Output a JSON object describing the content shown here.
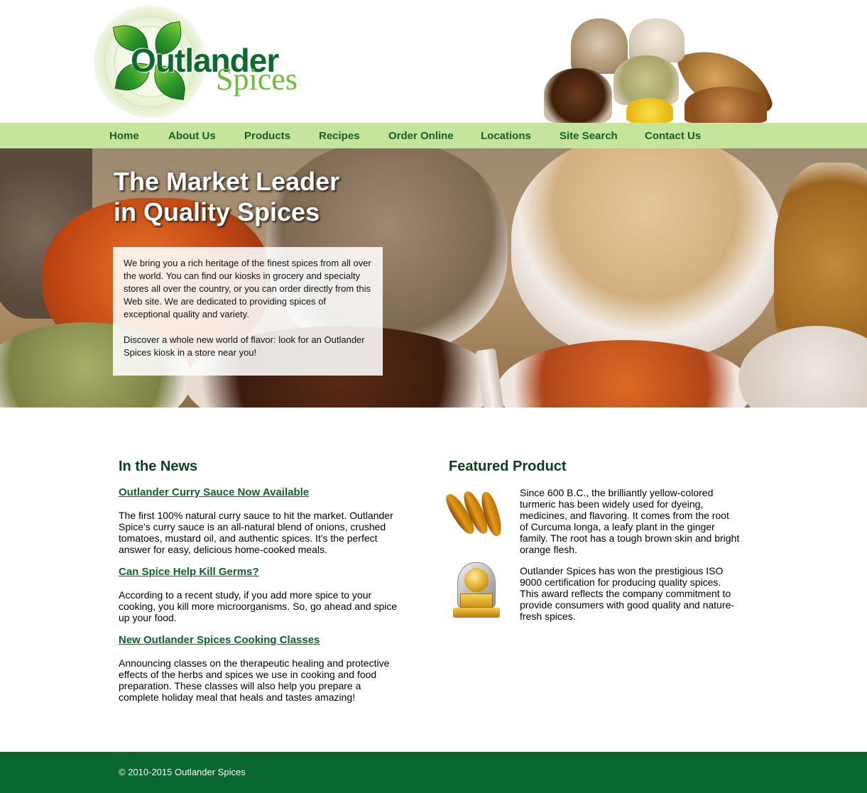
{
  "brand": {
    "name_word1": "Outlander",
    "name_word2": "Spices"
  },
  "nav": {
    "items": [
      {
        "label": "Home"
      },
      {
        "label": "About Us"
      },
      {
        "label": "Products"
      },
      {
        "label": "Recipes"
      },
      {
        "label": "Order Online"
      },
      {
        "label": "Locations"
      },
      {
        "label": "Site Search"
      },
      {
        "label": "Contact Us"
      }
    ]
  },
  "hero": {
    "title_line1": "The Market Leader",
    "title_line2": "in Quality Spices",
    "paragraph1": "We bring you a rich heritage of the finest spices from all over the world. You can find our kiosks in grocery and specialty stores all over the country, or you can order directly from this Web site. We are dedicated to providing spices of exceptional quality and variety.",
    "paragraph2": "Discover a whole new world of flavor: look for an Outlander Spices kiosk in a store near you!"
  },
  "news": {
    "heading": "In the News",
    "items": [
      {
        "title": "Outlander Curry Sauce Now Available",
        "body": "The first 100% natural curry sauce to hit the market. Outlander Spice's curry sauce is an all-natural blend of onions, crushed tomatoes, mustard oil, and authentic spices. It's the perfect answer for easy, delicious home-cooked meals."
      },
      {
        "title": "Can Spice Help Kill Germs?",
        "body": "According to a recent study, if you add more spice to your cooking, you kill more microorganisms. So, go ahead and spice up your food."
      },
      {
        "title": "New Outlander Spices Cooking Classes",
        "body": "Announcing classes on the therapeutic healing and protective effects of the herbs and spices we use in cooking and food preparation. These classes will also help you prepare a complete holiday meal that heals and tastes amazing!"
      }
    ]
  },
  "featured": {
    "heading": "Featured Product",
    "items": [
      {
        "icon": "turmeric-icon",
        "text": "Since 600 B.C., the brilliantly yellow-colored turmeric has been widely used for dyeing, medicines, and flavoring. It comes from the root of Curcuma longa, a leafy plant in the ginger family. The root has a tough brown skin and bright orange flesh."
      },
      {
        "icon": "iso-award-icon",
        "text": "Outlander Spices has won the prestigious ISO 9000 certification for producing quality spices. This award reflects the company commitment to provide consumers with good quality and nature-fresh spices."
      }
    ]
  },
  "footer": {
    "copyright": "© 2010-2015 Outlander Spices"
  },
  "colors": {
    "nav_bg": "#c5e59a",
    "link_green": "#13612d",
    "heading_green": "#0d3d1f",
    "footer_bg": "#086731"
  }
}
